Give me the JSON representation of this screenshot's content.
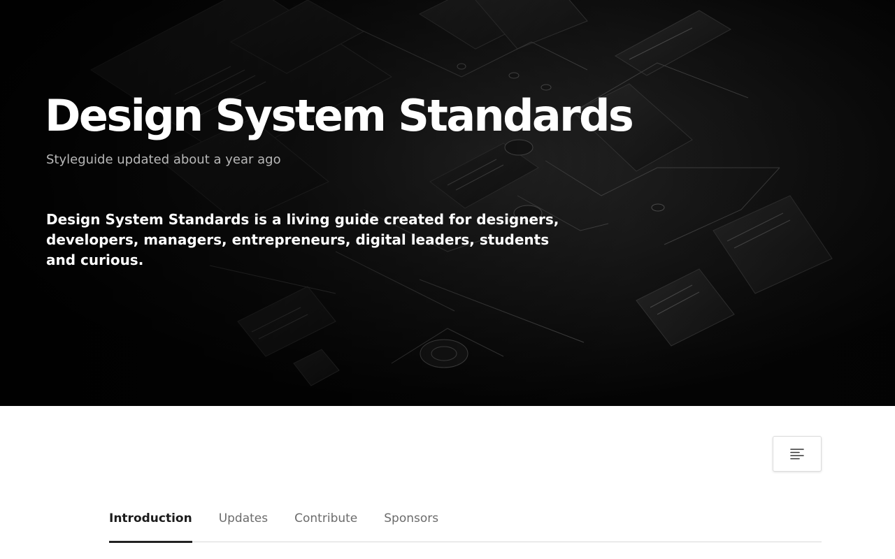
{
  "hero": {
    "title": "Design System Standards",
    "subtitle": "Styleguide updated about a year ago",
    "description": "Design System Standards is a living guide created for designers, developers, managers, entrepreneurs, digital leaders, students and curious."
  },
  "toc_button": {
    "icon": "table-of-contents-icon"
  },
  "tabs": [
    {
      "label": "Introduction",
      "active": true
    },
    {
      "label": "Updates",
      "active": false
    },
    {
      "label": "Contribute",
      "active": false
    },
    {
      "label": "Sponsors",
      "active": false
    }
  ],
  "colors": {
    "hero_background": "#0b0b0b",
    "title_text": "#ffffff",
    "subtitle_text": "#b8b8b8",
    "tab_inactive": "#6b6b6b",
    "tab_active": "#1c1c1c"
  }
}
